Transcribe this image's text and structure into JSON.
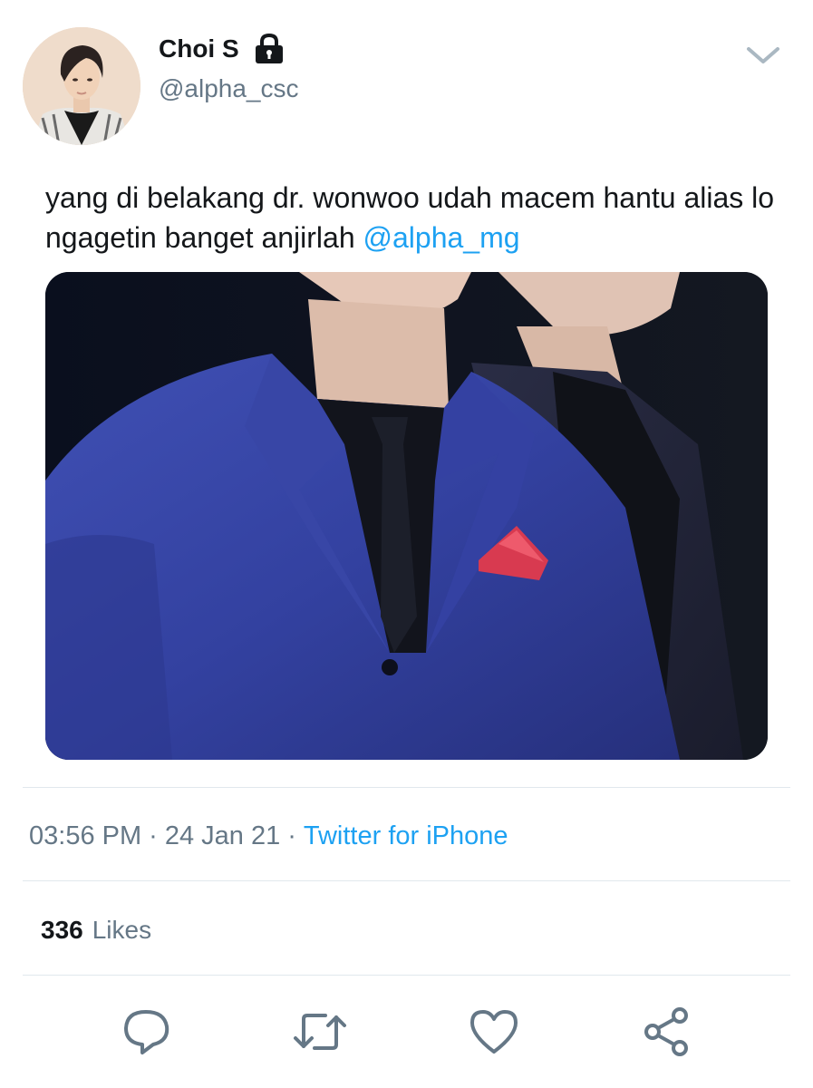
{
  "author": {
    "display_name": "Choi S",
    "handle": "@alpha_csc",
    "protected_icon": "lock-icon",
    "avatar_icon": "avatar"
  },
  "tweet": {
    "text": "yang di belakang dr. wonwoo udah macem hantu alias lo ngagetin banget anjirlah",
    "mention": "@alpha_mg"
  },
  "meta": {
    "time": "03:56 PM",
    "date": "24 Jan 21",
    "separator": "·",
    "source": "Twitter for iPhone"
  },
  "stats": {
    "likes_count": "336",
    "likes_label": "Likes"
  },
  "actions": {
    "reply_icon": "reply-icon",
    "retweet_icon": "retweet-icon",
    "like_icon": "heart-icon",
    "share_icon": "share-icon"
  },
  "colors": {
    "link": "#1da1f2",
    "secondary_text": "#657786",
    "primary_text": "#14171a",
    "divider": "#e1e8ed",
    "icon": "#657786"
  }
}
